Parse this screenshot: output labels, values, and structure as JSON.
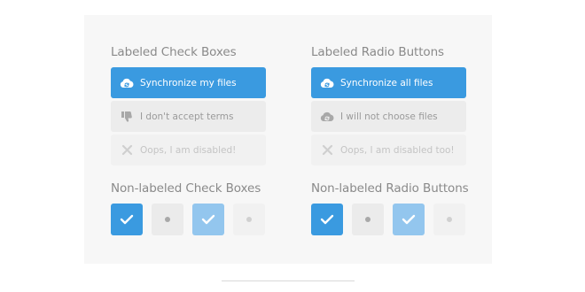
{
  "checkboxes": {
    "title": "Labeled Check Boxes",
    "options": [
      {
        "label": "Synchronize my files",
        "icon": "cloud-sync-icon",
        "state": "checked"
      },
      {
        "label": "I don't accept terms",
        "icon": "thumbs-down-icon",
        "state": "unchecked"
      },
      {
        "label": "Oops, I am disabled!",
        "icon": "close-icon",
        "state": "disabled"
      }
    ]
  },
  "radios": {
    "title": "Labeled Radio Buttons",
    "options": [
      {
        "label": "Synchronize all files",
        "icon": "cloud-sync-icon",
        "state": "checked"
      },
      {
        "label": "I will not choose files",
        "icon": "cloud-sync-icon",
        "state": "unchecked"
      },
      {
        "label": "Oops, I am disabled too!",
        "icon": "close-icon",
        "state": "disabled"
      }
    ]
  },
  "nonlabeled_checkboxes": {
    "title": "Non-labeled Check Boxes",
    "states": [
      "checked",
      "unchecked",
      "checked-disabled",
      "unchecked-disabled"
    ]
  },
  "nonlabeled_radios": {
    "title": "Non-labeled Radio Buttons",
    "states": [
      "checked",
      "unchecked",
      "checked-disabled",
      "unchecked-disabled"
    ]
  },
  "colors": {
    "accent": "#3a9ae0",
    "accent_light": "#93c6ee",
    "panel": "#f7f7f7"
  }
}
